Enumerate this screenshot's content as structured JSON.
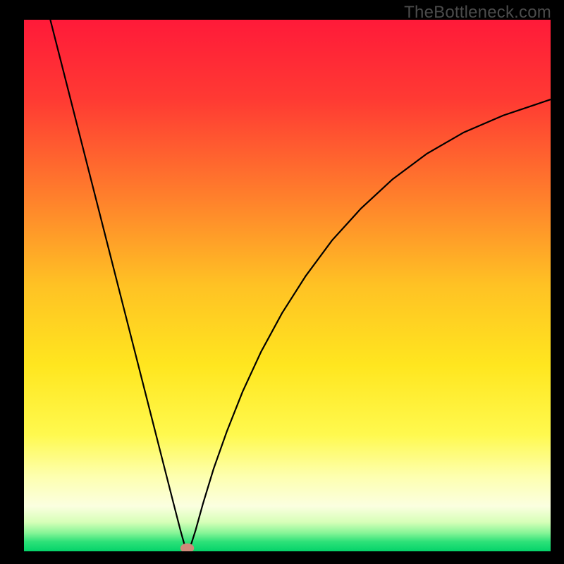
{
  "watermark": "TheBottleneck.com",
  "chart_data": {
    "type": "line",
    "title": "",
    "xlabel": "",
    "ylabel": "",
    "xlim": [
      0,
      100
    ],
    "ylim": [
      0,
      100
    ],
    "gradient_stops": [
      {
        "offset": 0.0,
        "color": "#ff1a39"
      },
      {
        "offset": 0.15,
        "color": "#ff3a33"
      },
      {
        "offset": 0.33,
        "color": "#ff7e2c"
      },
      {
        "offset": 0.5,
        "color": "#ffc224"
      },
      {
        "offset": 0.65,
        "color": "#ffe61f"
      },
      {
        "offset": 0.78,
        "color": "#fff94e"
      },
      {
        "offset": 0.86,
        "color": "#fdffb0"
      },
      {
        "offset": 0.915,
        "color": "#fbffe0"
      },
      {
        "offset": 0.945,
        "color": "#d7ffb8"
      },
      {
        "offset": 0.965,
        "color": "#89f598"
      },
      {
        "offset": 0.982,
        "color": "#2de178"
      },
      {
        "offset": 1.0,
        "color": "#05d36a"
      }
    ],
    "series": [
      {
        "name": "bottleneck-curve",
        "color": "#000000",
        "width": 2.2,
        "points": [
          {
            "x": 5.0,
            "y": 100.0
          },
          {
            "x": 6.8,
            "y": 93.0
          },
          {
            "x": 8.6,
            "y": 86.0
          },
          {
            "x": 10.4,
            "y": 79.0
          },
          {
            "x": 12.2,
            "y": 72.0
          },
          {
            "x": 14.0,
            "y": 65.0
          },
          {
            "x": 15.8,
            "y": 58.0
          },
          {
            "x": 17.6,
            "y": 51.0
          },
          {
            "x": 19.4,
            "y": 44.0
          },
          {
            "x": 21.2,
            "y": 37.0
          },
          {
            "x": 23.0,
            "y": 30.0
          },
          {
            "x": 24.8,
            "y": 23.0
          },
          {
            "x": 26.6,
            "y": 16.0
          },
          {
            "x": 28.4,
            "y": 9.0
          },
          {
            "x": 29.7,
            "y": 4.0
          },
          {
            "x": 30.4,
            "y": 1.5
          },
          {
            "x": 30.8,
            "y": 0.5
          },
          {
            "x": 31.2,
            "y": 0.5
          },
          {
            "x": 31.8,
            "y": 1.5
          },
          {
            "x": 32.6,
            "y": 4.0
          },
          {
            "x": 34.0,
            "y": 9.0
          },
          {
            "x": 36.0,
            "y": 15.5
          },
          {
            "x": 38.5,
            "y": 22.5
          },
          {
            "x": 41.5,
            "y": 30.0
          },
          {
            "x": 45.0,
            "y": 37.5
          },
          {
            "x": 49.0,
            "y": 44.8
          },
          {
            "x": 53.5,
            "y": 51.8
          },
          {
            "x": 58.5,
            "y": 58.5
          },
          {
            "x": 64.0,
            "y": 64.5
          },
          {
            "x": 70.0,
            "y": 70.0
          },
          {
            "x": 76.5,
            "y": 74.8
          },
          {
            "x": 83.5,
            "y": 78.8
          },
          {
            "x": 91.0,
            "y": 82.0
          },
          {
            "x": 100.0,
            "y": 85.0
          }
        ]
      }
    ],
    "marker": {
      "x": 31.0,
      "y": 0.6,
      "rx": 1.3,
      "ry": 0.9,
      "fill": "#cf8a7a"
    }
  }
}
